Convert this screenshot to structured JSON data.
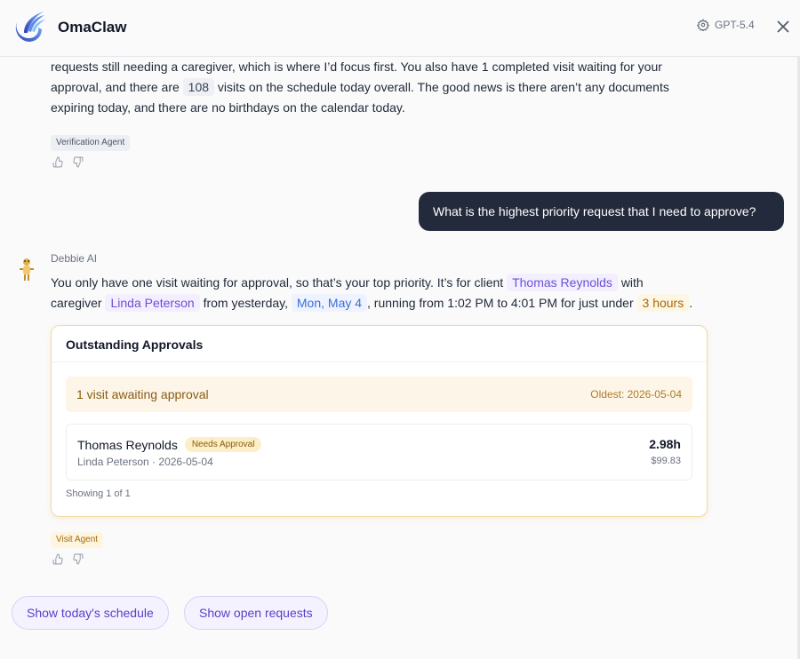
{
  "header": {
    "app_title": "OmaClaw",
    "model_label": "GPT-5.4"
  },
  "message1": {
    "line1": "requests still needing a caregiver, which is where I’d focus first. You also have 1 completed visit waiting for your",
    "line2_a": "approval, and there are",
    "visits_count": "108",
    "line2_b": "visits on the schedule today overall. The good news is there aren’t any documents",
    "line3": "expiring today, and there are no birthdays on the calendar today.",
    "agent_tag": "Verification Agent"
  },
  "user_message": "What is the highest priority request that I need to approve?",
  "bot": {
    "name": "Debbie AI",
    "text_a": "You only have one visit waiting for approval, so that’s your top priority. It’s for client",
    "client": "Thomas Reynolds",
    "text_b": "with",
    "text_c": "caregiver",
    "caregiver": "Linda Peterson",
    "text_d": "from yesterday,",
    "date": "Mon, May 4",
    "text_e": ", running from 1:02 PM to 4:01 PM for just under",
    "duration": "3 hours",
    "text_f": ".",
    "agent_tag": "Visit Agent"
  },
  "card": {
    "title": "Outstanding Approvals",
    "banner_left": "1 visit awaiting approval",
    "banner_right": "Oldest: 2026-05-04",
    "row": {
      "name": "Thomas Reynolds",
      "badge": "Needs Approval",
      "sub": "Linda Peterson · 2026-05-04",
      "hours": "2.98h",
      "amount": "$99.83"
    },
    "showing": "Showing 1 of 1"
  },
  "suggestions": [
    "Show today's schedule",
    "Show open requests"
  ],
  "colors": {
    "accent_purple": "#6d4fd6",
    "user_bubble": "#232a3b",
    "card_border": "#f1d9a3"
  }
}
